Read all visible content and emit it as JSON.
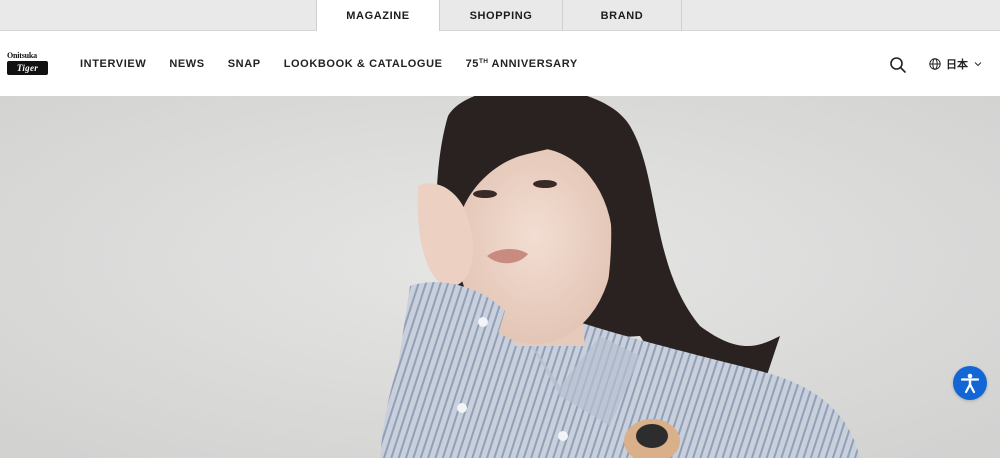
{
  "top_tabs": [
    {
      "label": "MAGAZINE"
    },
    {
      "label": "SHOPPING"
    },
    {
      "label": "BRAND"
    }
  ],
  "logo": {
    "line1": "Onitsuka",
    "line2": "Tiger"
  },
  "nav": {
    "items": [
      {
        "label": "INTERVIEW"
      },
      {
        "label": "NEWS"
      },
      {
        "label": "SNAP"
      },
      {
        "label": "LOOKBOOK & CATALOGUE"
      }
    ],
    "anniversary": {
      "number": "75",
      "suffix": "TH",
      "rest": " ANNIVERSARY"
    }
  },
  "language": {
    "label": "日本"
  },
  "icons": {
    "search": "search-icon",
    "globe": "globe-icon",
    "chevron": "chevron-down-icon",
    "accessibility": "accessibility-icon"
  },
  "colors": {
    "accessibility_button": "#1366d6",
    "top_strip": "#e9e9e9",
    "hero_background": "#dcdcdb",
    "shirt_stripe": "#8fa0b8"
  }
}
